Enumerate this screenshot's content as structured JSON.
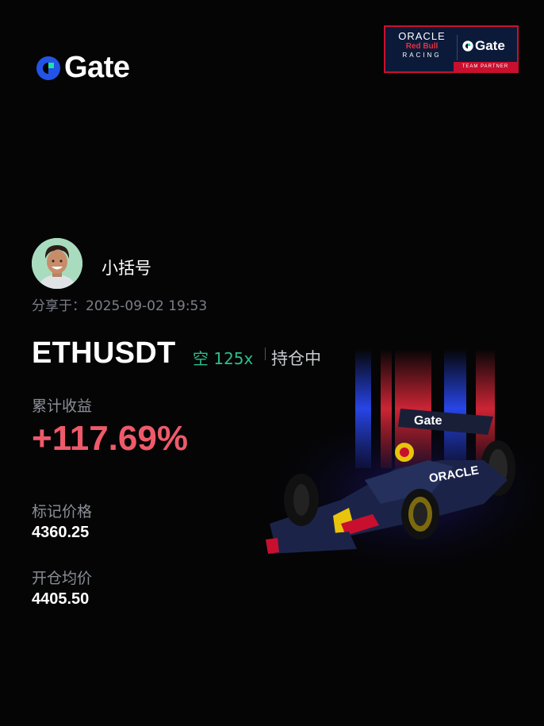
{
  "brand": {
    "name": "Gate",
    "accent": "#2354e6",
    "accent_green": "#17e6a1"
  },
  "partner_badge": {
    "line1": "ORACLE",
    "line2": "Red Bull",
    "line3": "RACING",
    "brand": "Gate",
    "tagline": "TEAM PARTNER"
  },
  "user": {
    "name": "小括号",
    "shared_prefix": "分享于：",
    "shared_time": "2025-09-02 19:53"
  },
  "position": {
    "pair": "ETHUSDT",
    "side_leverage": "空 125x",
    "status": "持仓中",
    "pnl_label": "累计收益",
    "pnl_value": "+117.69%",
    "mark_label": "标记价格",
    "mark_value": "4360.25",
    "entry_label": "开仓均价",
    "entry_value": "4405.50"
  },
  "colors": {
    "positive": "#ef5a6a",
    "short": "#2bbf8b"
  },
  "icons": [
    "gate-logo-icon",
    "avatar-image",
    "f1-car-image"
  ]
}
